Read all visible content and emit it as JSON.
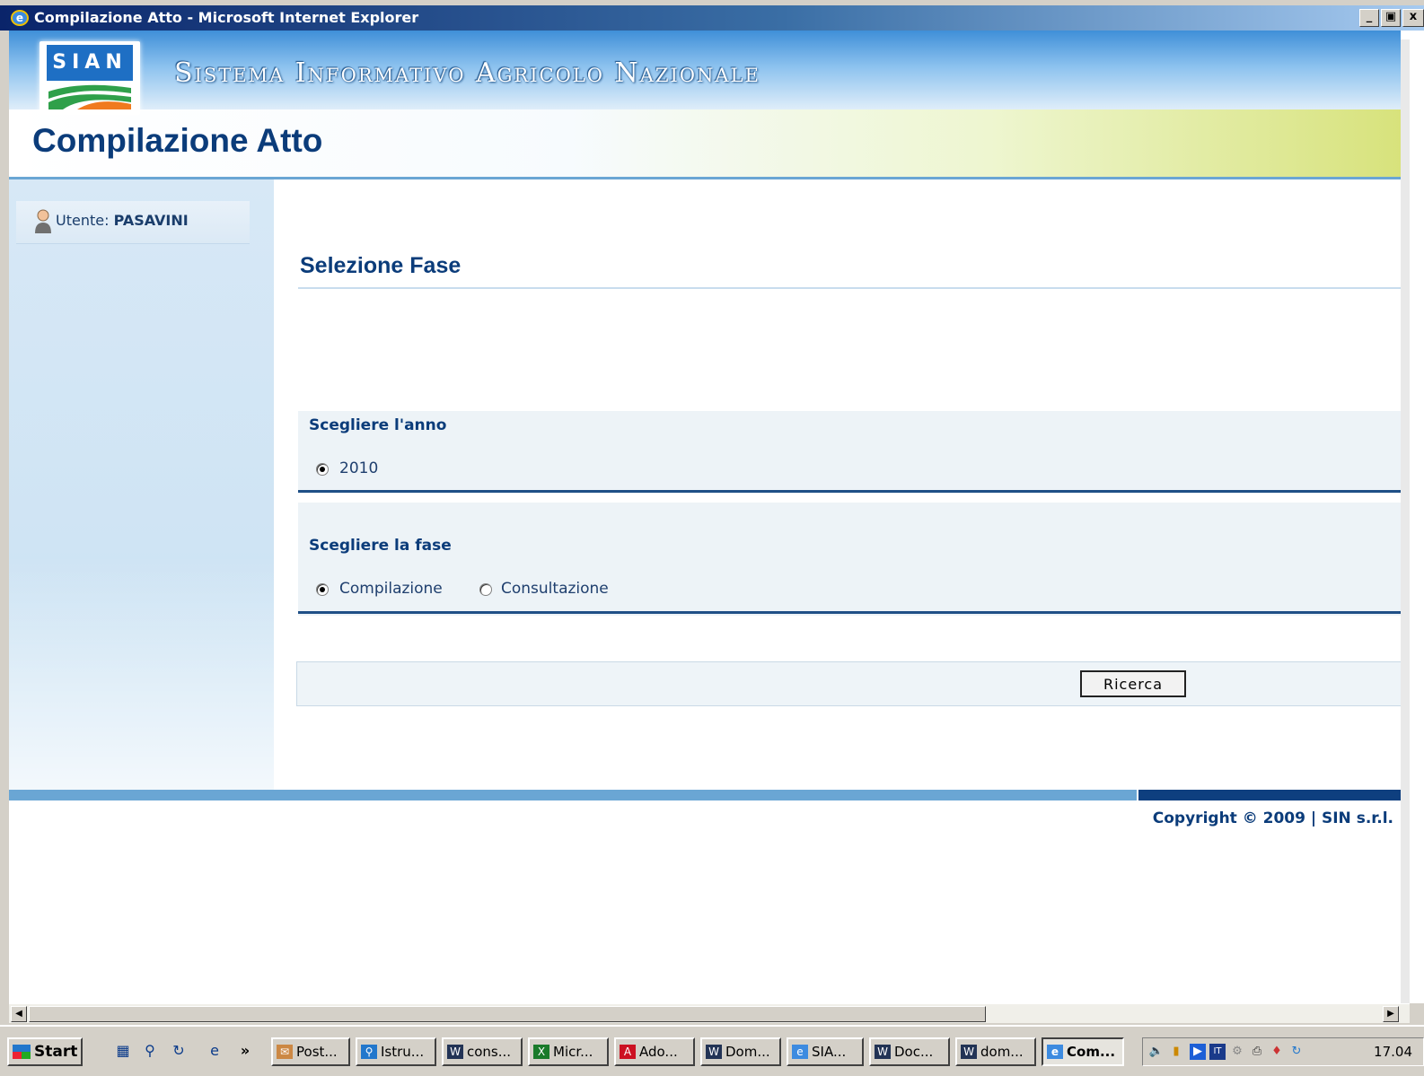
{
  "window": {
    "title": "Compilazione Atto - Microsoft Internet Explorer",
    "controls": [
      "_",
      "ᴮ",
      "x"
    ]
  },
  "header": {
    "logo_text": "SIAN",
    "system_name": "Sistema Informativo Agricolo Nazionale",
    "page_title": "Compilazione Atto"
  },
  "sidebar": {
    "user_prefix": "Utente:",
    "user_name": "PASAVINI"
  },
  "main": {
    "section_title": "Selezione Fase",
    "year_group": {
      "label": "Scegliere l'anno",
      "options": [
        {
          "label": "2010",
          "checked": true
        }
      ]
    },
    "phase_group": {
      "label": "Scegliere la fase",
      "options": [
        {
          "label": "Compilazione",
          "checked": true
        },
        {
          "label": "Consultazione",
          "checked": false
        }
      ]
    },
    "search_button": "Ricerca"
  },
  "footer": {
    "copyright": "Copyright © 2009 | SIN s.r.l."
  },
  "taskbar": {
    "start_label": "Start",
    "chevron": "»",
    "tasks": [
      {
        "label": "Post...",
        "icon": "postit-icon"
      },
      {
        "label": "Istru...",
        "icon": "search-doc-icon"
      },
      {
        "label": "cons...",
        "icon": "word-icon"
      },
      {
        "label": "Micr...",
        "icon": "excel-icon"
      },
      {
        "label": "Ado...",
        "icon": "acrobat-icon"
      },
      {
        "label": "Dom...",
        "icon": "word-icon"
      },
      {
        "label": "SIA...",
        "icon": "ie-icon"
      },
      {
        "label": "Doc...",
        "icon": "word-icon"
      },
      {
        "label": "dom...",
        "icon": "word-icon"
      },
      {
        "label": "Com...",
        "icon": "ie-icon",
        "active": true
      }
    ],
    "tray_lang": "IT",
    "clock": "17.04"
  }
}
